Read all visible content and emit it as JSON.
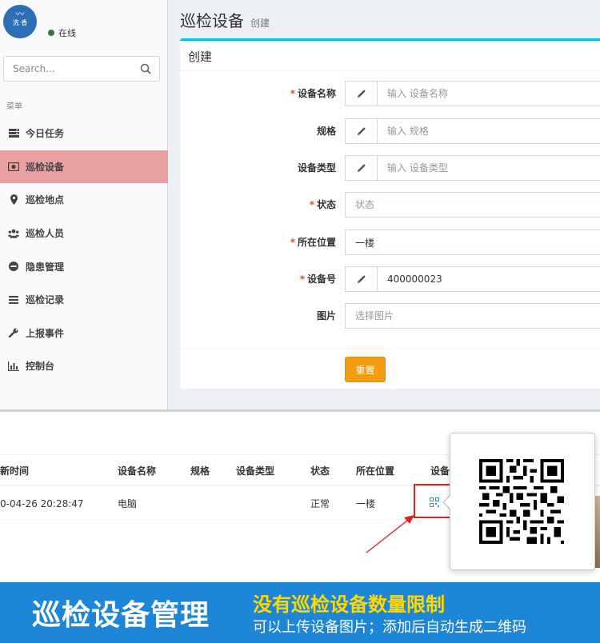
{
  "user": {
    "avatar_text": "洗 香",
    "status": "在线"
  },
  "search": {
    "placeholder": "Search..."
  },
  "menu": {
    "header": "菜单",
    "items": [
      {
        "label": "今日任务",
        "icon": "tasks-icon"
      },
      {
        "label": "巡检设备",
        "icon": "device-icon",
        "active": true
      },
      {
        "label": "巡检地点",
        "icon": "map-marker-icon"
      },
      {
        "label": "巡检人员",
        "icon": "users-icon"
      },
      {
        "label": "隐患管理",
        "icon": "minus-circle-icon"
      },
      {
        "label": "巡检记录",
        "icon": "list-icon"
      },
      {
        "label": "上报事件",
        "icon": "wrench-icon"
      },
      {
        "label": "控制台",
        "icon": "bar-chart-icon"
      }
    ]
  },
  "page": {
    "title": "巡检设备",
    "subtitle": "创建"
  },
  "form": {
    "header": "创建",
    "fields": [
      {
        "label": "设备名称",
        "required": true,
        "placeholder": "输入 设备名称",
        "value": ""
      },
      {
        "label": "规格",
        "required": false,
        "placeholder": "输入 规格",
        "value": ""
      },
      {
        "label": "设备类型",
        "required": false,
        "placeholder": "输入 设备类型",
        "value": ""
      },
      {
        "label": "状态",
        "required": true,
        "placeholder": "状态",
        "value": ""
      },
      {
        "label": "所在位置",
        "required": true,
        "placeholder": "",
        "value": "一楼"
      },
      {
        "label": "设备号",
        "required": true,
        "placeholder": "",
        "value": "400000023"
      },
      {
        "label": "图片",
        "required": false,
        "placeholder": "选择图片",
        "value": ""
      }
    ],
    "reset_label": "重置"
  },
  "table": {
    "headers": [
      "新时间",
      "设备名称",
      "规格",
      "设备类型",
      "状态",
      "所在位置",
      "设备"
    ],
    "rows": [
      {
        "time": "0-04-26 20:28:47",
        "name": "电脑",
        "spec": "",
        "type": "",
        "status": "正常",
        "location": "一楼"
      }
    ]
  },
  "banner": {
    "title": "巡检设备管理",
    "line1": "没有巡检设备数量限制",
    "line2": "可以上传设备图片；添加后自动生成二维码"
  },
  "colors": {
    "accent": "#00c0ef",
    "active_menu": "#e9a0a0",
    "reset_button": "#f39c12",
    "banner_bg": "#1d86d6",
    "banner_highlight": "#ffd800",
    "highlight_box": "#e0201b"
  }
}
